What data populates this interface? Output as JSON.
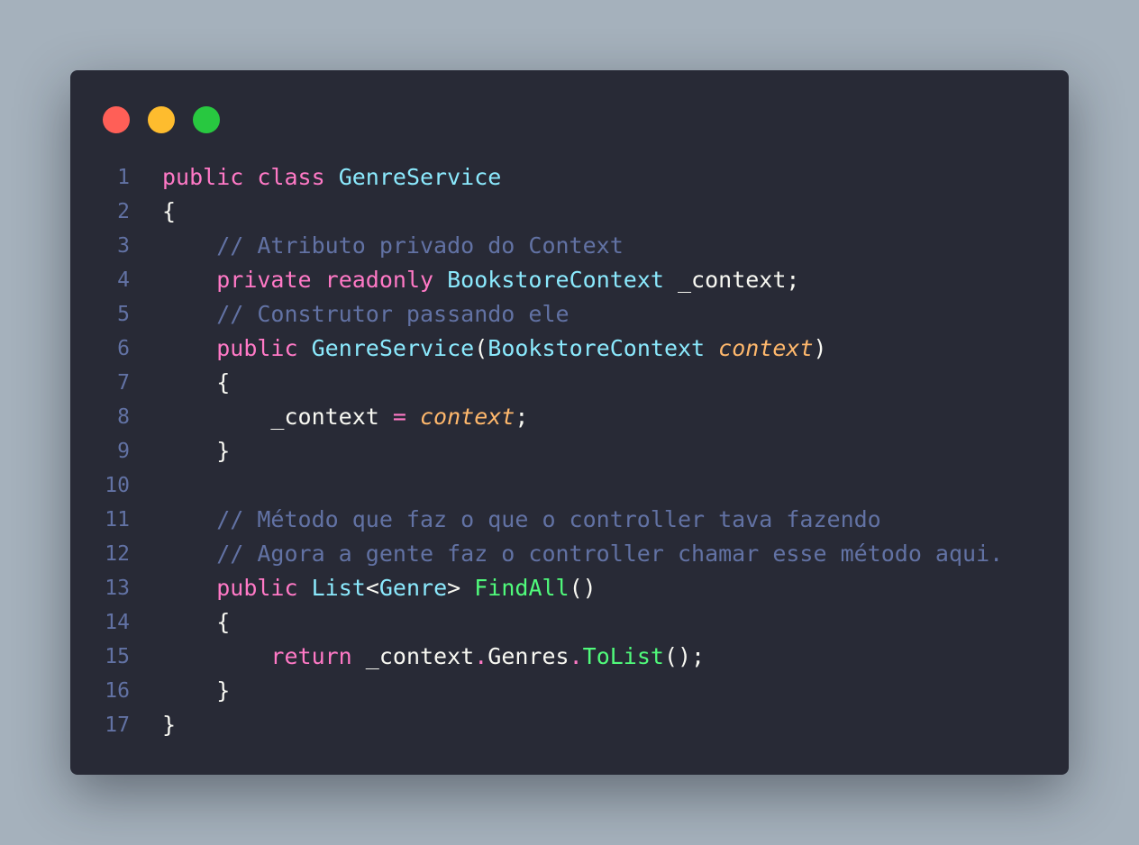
{
  "window": {
    "controls": [
      {
        "name": "close",
        "color": "#ff5f57"
      },
      {
        "name": "minimize",
        "color": "#febc2e"
      },
      {
        "name": "maximize",
        "color": "#28c840"
      }
    ]
  },
  "code": {
    "language": "csharp",
    "lines": [
      {
        "number": "1",
        "tokens": [
          {
            "t": "public",
            "k": "keyword"
          },
          {
            "t": " ",
            "k": "plain"
          },
          {
            "t": "class",
            "k": "keyword"
          },
          {
            "t": " ",
            "k": "plain"
          },
          {
            "t": "GenreService",
            "k": "type"
          }
        ]
      },
      {
        "number": "2",
        "tokens": [
          {
            "t": "{",
            "k": "plain"
          }
        ]
      },
      {
        "number": "3",
        "tokens": [
          {
            "t": "    ",
            "k": "plain"
          },
          {
            "t": "// Atributo privado do Context",
            "k": "comment"
          }
        ]
      },
      {
        "number": "4",
        "tokens": [
          {
            "t": "    ",
            "k": "plain"
          },
          {
            "t": "private",
            "k": "keyword"
          },
          {
            "t": " ",
            "k": "plain"
          },
          {
            "t": "readonly",
            "k": "keyword"
          },
          {
            "t": " ",
            "k": "plain"
          },
          {
            "t": "BookstoreContext",
            "k": "type"
          },
          {
            "t": " _context;",
            "k": "plain"
          }
        ]
      },
      {
        "number": "5",
        "tokens": [
          {
            "t": "    ",
            "k": "plain"
          },
          {
            "t": "// Construtor passando ele",
            "k": "comment"
          }
        ]
      },
      {
        "number": "6",
        "tokens": [
          {
            "t": "    ",
            "k": "plain"
          },
          {
            "t": "public",
            "k": "keyword"
          },
          {
            "t": " ",
            "k": "plain"
          },
          {
            "t": "GenreService",
            "k": "type"
          },
          {
            "t": "(",
            "k": "plain"
          },
          {
            "t": "BookstoreContext",
            "k": "type"
          },
          {
            "t": " ",
            "k": "plain"
          },
          {
            "t": "context",
            "k": "param"
          },
          {
            "t": ")",
            "k": "plain"
          }
        ]
      },
      {
        "number": "7",
        "tokens": [
          {
            "t": "    {",
            "k": "plain"
          }
        ]
      },
      {
        "number": "8",
        "tokens": [
          {
            "t": "        _context ",
            "k": "plain"
          },
          {
            "t": "=",
            "k": "op"
          },
          {
            "t": " ",
            "k": "plain"
          },
          {
            "t": "context",
            "k": "param"
          },
          {
            "t": ";",
            "k": "plain"
          }
        ]
      },
      {
        "number": "9",
        "tokens": [
          {
            "t": "    }",
            "k": "plain"
          }
        ]
      },
      {
        "number": "10",
        "tokens": []
      },
      {
        "number": "11",
        "tokens": [
          {
            "t": "    ",
            "k": "plain"
          },
          {
            "t": "// Método que faz o que o controller tava fazendo",
            "k": "comment"
          }
        ]
      },
      {
        "number": "12",
        "tokens": [
          {
            "t": "    ",
            "k": "plain"
          },
          {
            "t": "// Agora a gente faz o controller chamar esse método aqui.",
            "k": "comment"
          }
        ]
      },
      {
        "number": "13",
        "tokens": [
          {
            "t": "    ",
            "k": "plain"
          },
          {
            "t": "public",
            "k": "keyword"
          },
          {
            "t": " ",
            "k": "plain"
          },
          {
            "t": "List",
            "k": "type"
          },
          {
            "t": "<",
            "k": "plain"
          },
          {
            "t": "Genre",
            "k": "type"
          },
          {
            "t": "> ",
            "k": "plain"
          },
          {
            "t": "FindAll",
            "k": "func"
          },
          {
            "t": "()",
            "k": "plain"
          }
        ]
      },
      {
        "number": "14",
        "tokens": [
          {
            "t": "    {",
            "k": "plain"
          }
        ]
      },
      {
        "number": "15",
        "tokens": [
          {
            "t": "        ",
            "k": "plain"
          },
          {
            "t": "return",
            "k": "keyword"
          },
          {
            "t": " _context",
            "k": "plain"
          },
          {
            "t": ".",
            "k": "op"
          },
          {
            "t": "Genres",
            "k": "plain"
          },
          {
            "t": ".",
            "k": "op"
          },
          {
            "t": "ToList",
            "k": "func"
          },
          {
            "t": "();",
            "k": "plain"
          }
        ]
      },
      {
        "number": "16",
        "tokens": [
          {
            "t": "    }",
            "k": "plain"
          }
        ]
      },
      {
        "number": "17",
        "tokens": [
          {
            "t": "}",
            "k": "plain"
          }
        ]
      }
    ]
  }
}
